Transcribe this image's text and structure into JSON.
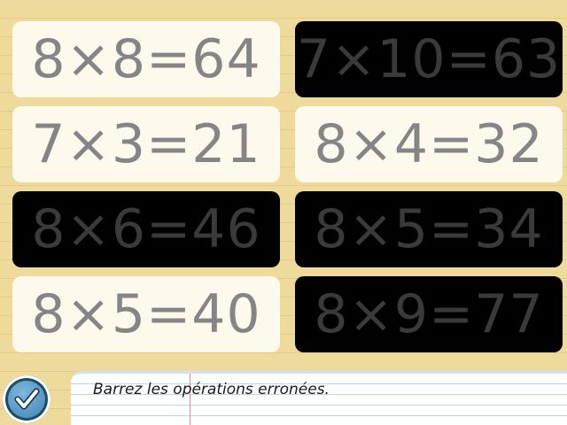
{
  "equations": [
    {
      "text": "8×8=64",
      "crossed": false
    },
    {
      "text": "7×10=63",
      "crossed": true
    },
    {
      "text": "7×3=21",
      "crossed": false
    },
    {
      "text": "8×4=32",
      "crossed": false
    },
    {
      "text": "8×6=46",
      "crossed": true
    },
    {
      "text": "8×5=34",
      "crossed": true
    },
    {
      "text": "8×5=40",
      "crossed": false
    },
    {
      "text": "8×9=77",
      "crossed": true
    }
  ],
  "instruction": "Barrez les opérations erronées.",
  "check_button": {
    "icon": "check-icon"
  },
  "colors": {
    "background": "#eedb9b",
    "card_light": "#fdf9ec",
    "card_dark": "#000000",
    "equation_text": "#858585",
    "check_button": "#3f86b5"
  }
}
